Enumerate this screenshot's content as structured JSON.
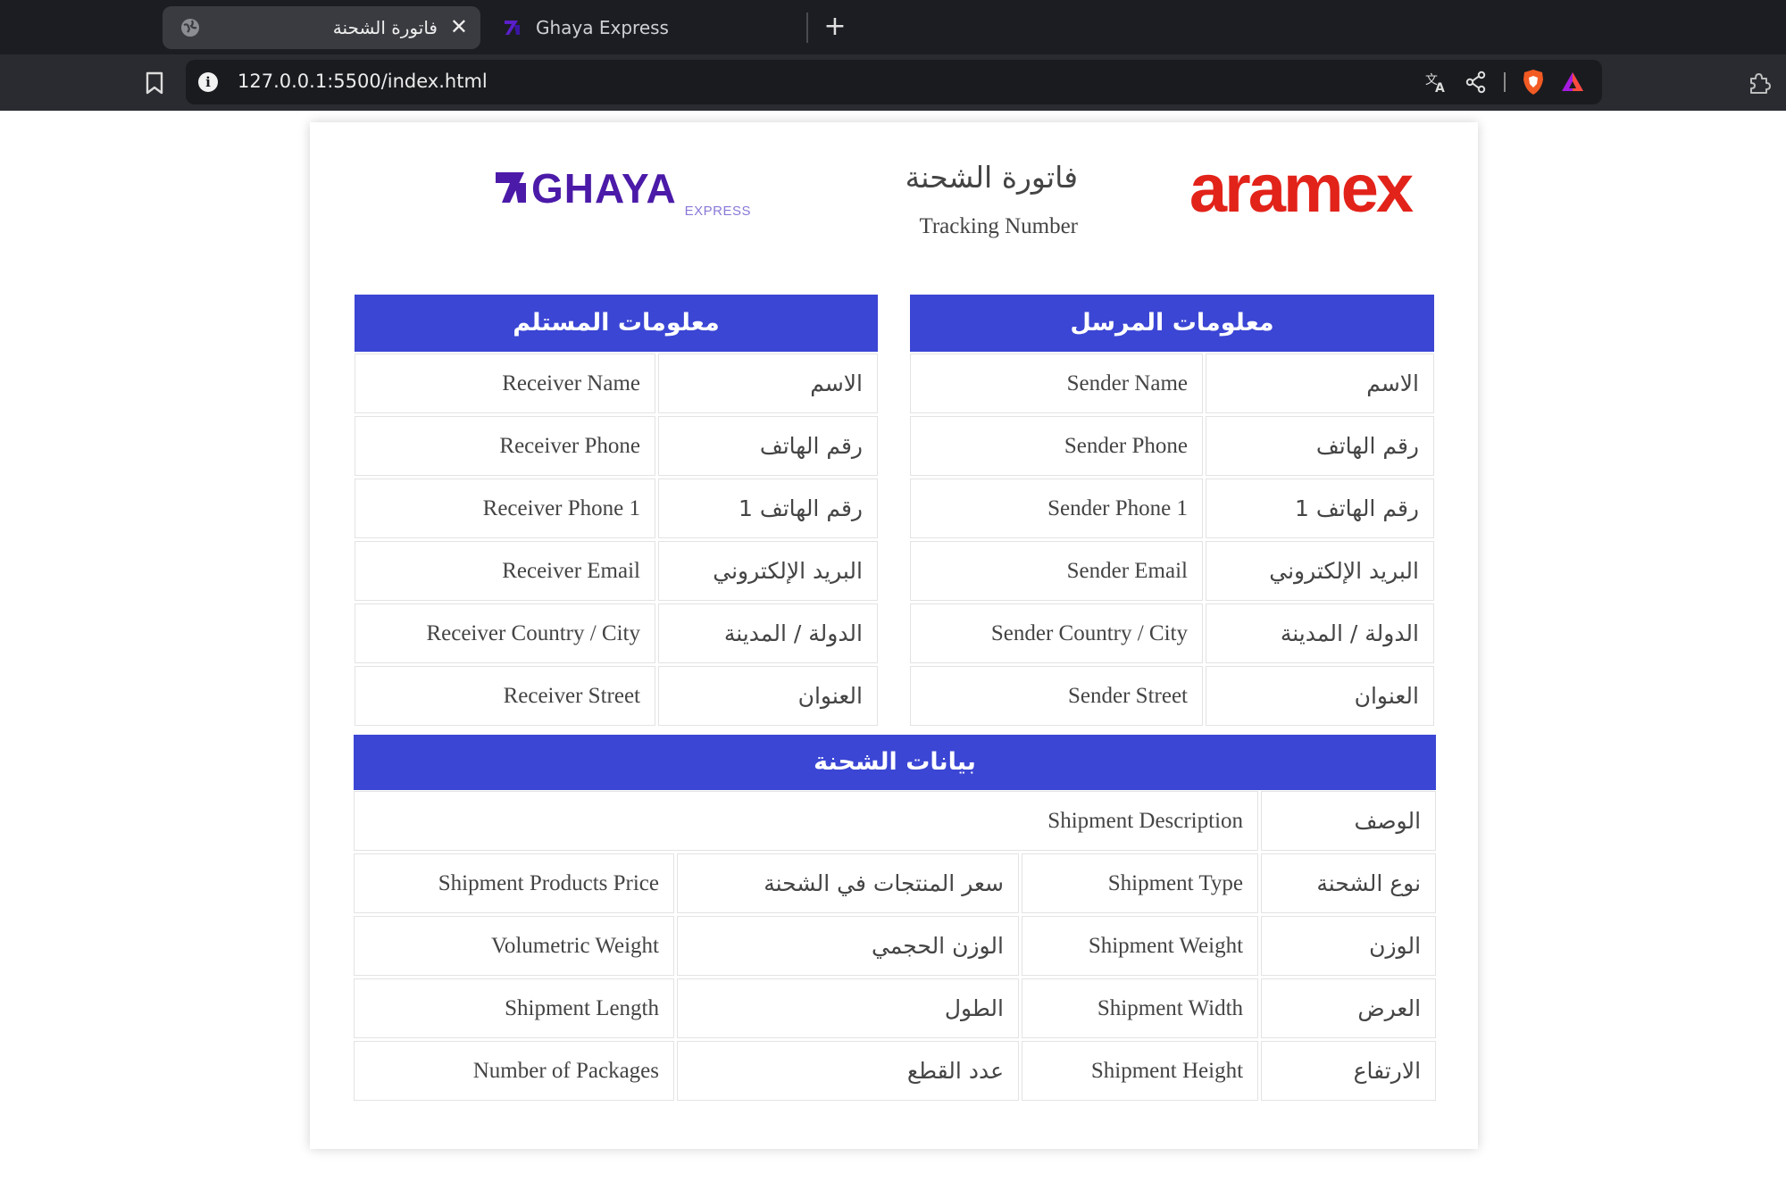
{
  "browser": {
    "tabs": [
      {
        "title": "فاتورة الشحنة",
        "active": true,
        "icon": "globe-icon"
      },
      {
        "title": "Ghaya Express",
        "active": false,
        "icon": "ghaya-favicon"
      }
    ],
    "new_tab_label": "+",
    "close_label": "✕",
    "url": "127.0.0.1:5500/index.html",
    "info_label": "i"
  },
  "invoice": {
    "title": "فاتورة الشحنة",
    "tracking_label": "Tracking Number",
    "logos": {
      "aramex": "aramex",
      "ghaya": "GHAYA",
      "ghaya_sub": "EXPRESS"
    },
    "colors": {
      "header_bg": "#3b46d4",
      "aramex_red": "#e2231a",
      "ghaya_purple": "#4b1aa8"
    }
  },
  "sender": {
    "header": "معلومات المرسل",
    "rows": [
      {
        "label": "الاسم",
        "value": "Sender Name"
      },
      {
        "label": "رقم الهاتف",
        "value": "Sender Phone"
      },
      {
        "label": "رقم الهاتف 1",
        "value": "Sender Phone 1"
      },
      {
        "label": "البريد الإلكتروني",
        "value": "Sender Email"
      },
      {
        "label": "الدولة / المدينة",
        "value": "Sender Country / City"
      },
      {
        "label": "العنوان",
        "value": "Sender Street"
      }
    ]
  },
  "receiver": {
    "header": "معلومات المستلم",
    "rows": [
      {
        "label": "الاسم",
        "value": "Receiver Name"
      },
      {
        "label": "رقم الهاتف",
        "value": "Receiver Phone"
      },
      {
        "label": "رقم الهاتف 1",
        "value": "Receiver Phone 1"
      },
      {
        "label": "البريد الإلكتروني",
        "value": "Receiver Email"
      },
      {
        "label": "الدولة / المدينة",
        "value": "Receiver Country / City"
      },
      {
        "label": "العنوان",
        "value": "Receiver Street"
      }
    ]
  },
  "shipment": {
    "header": "بيانات الشحنة",
    "description": {
      "label": "الوصف",
      "value": "Shipment Description"
    },
    "rows": [
      {
        "label1": "نوع الشحنة",
        "value1": "Shipment Type",
        "label2": "سعر المنتجات في الشحنة",
        "value2": "Shipment Products Price"
      },
      {
        "label1": "الوزن",
        "value1": "Shipment Weight",
        "label2": "الوزن الحجمي",
        "value2": "Volumetric Weight"
      },
      {
        "label1": "العرض",
        "value1": "Shipment Width",
        "label2": "الطول",
        "value2": "Shipment Length"
      },
      {
        "label1": "الارتفاع",
        "value1": "Shipment Height",
        "label2": "عدد القطع",
        "value2": "Number of Packages"
      }
    ]
  }
}
